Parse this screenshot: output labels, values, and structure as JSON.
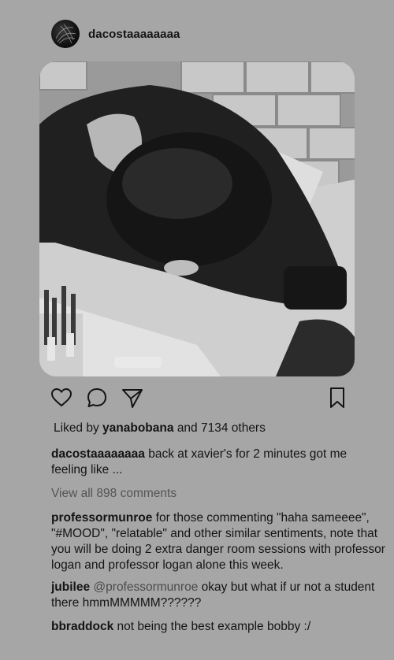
{
  "post": {
    "username": "dacostaaaaaaaa",
    "likes": {
      "prefix": "Liked by",
      "liker": "yanabobana",
      "suffix": "and 7134 others"
    },
    "caption": {
      "username": "dacostaaaaaaaa",
      "text": "back at xavier's for 2 minutes got me feeling like ..."
    },
    "view_all_comments": "View all 898 comments",
    "comments": [
      {
        "username": "professormunroe",
        "mention": "",
        "text": "for those commenting \"haha sameeee\", \"#MOOD\", \"relatable\" and other similar sentiments, note that you will be doing 2 extra danger room sessions with professor logan and professor logan alone this week."
      },
      {
        "username": "jubilee",
        "mention": "@professormunroe",
        "text": "okay but what if ur not a student there hmmMMMMM??????"
      },
      {
        "username": "bbraddock",
        "mention": "",
        "text": "not being the best example bobby :/"
      }
    ]
  },
  "icons": [
    "heart-icon",
    "comment-icon",
    "share-icon",
    "bookmark-icon"
  ],
  "colors": {
    "background": "#a6a6a6",
    "text": "#141414",
    "muted": "#555555"
  }
}
